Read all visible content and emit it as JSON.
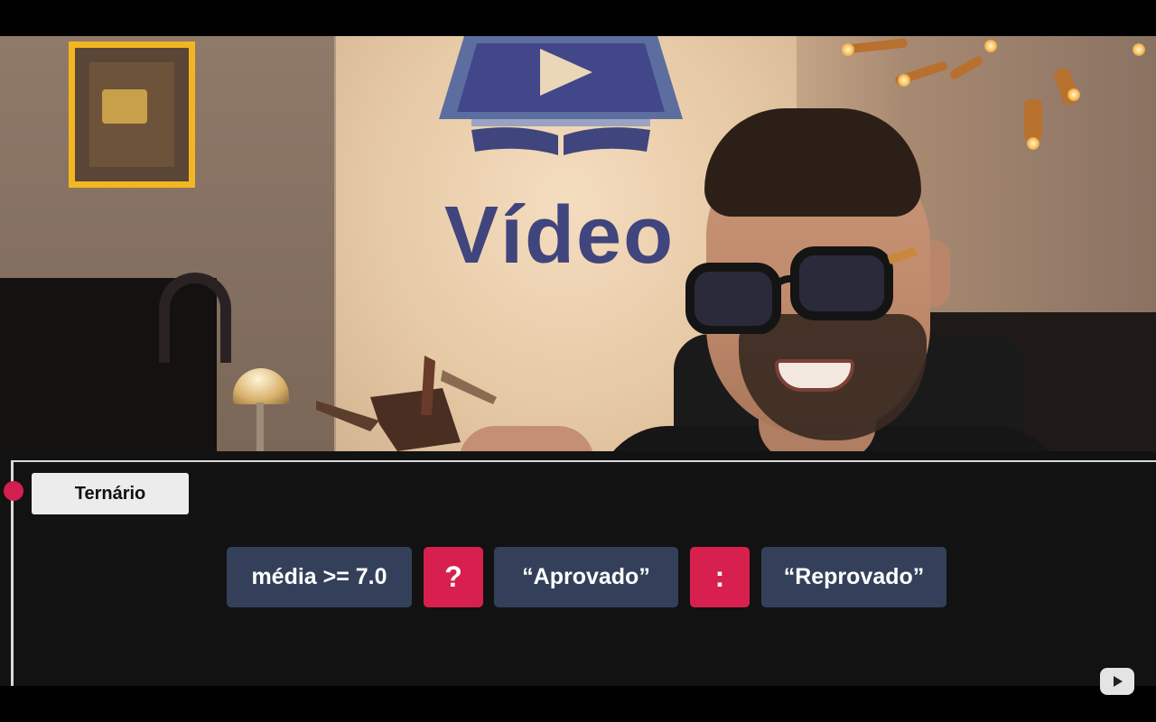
{
  "video": {
    "logo_text": "Vídeo"
  },
  "panel": {
    "title": "Ternário",
    "expression": {
      "condition": "média >= 7.0",
      "question_op": "?",
      "true_value": "“Aprovado”",
      "colon_op": ":",
      "false_value": "“Reprovado”"
    }
  },
  "colors": {
    "accent": "#d8204e",
    "chip": "#34405a",
    "panel_bg": "#121212",
    "tag_bg": "#ececec"
  },
  "icons": {
    "record": "record-dot-icon",
    "player": "video-player-icon"
  }
}
